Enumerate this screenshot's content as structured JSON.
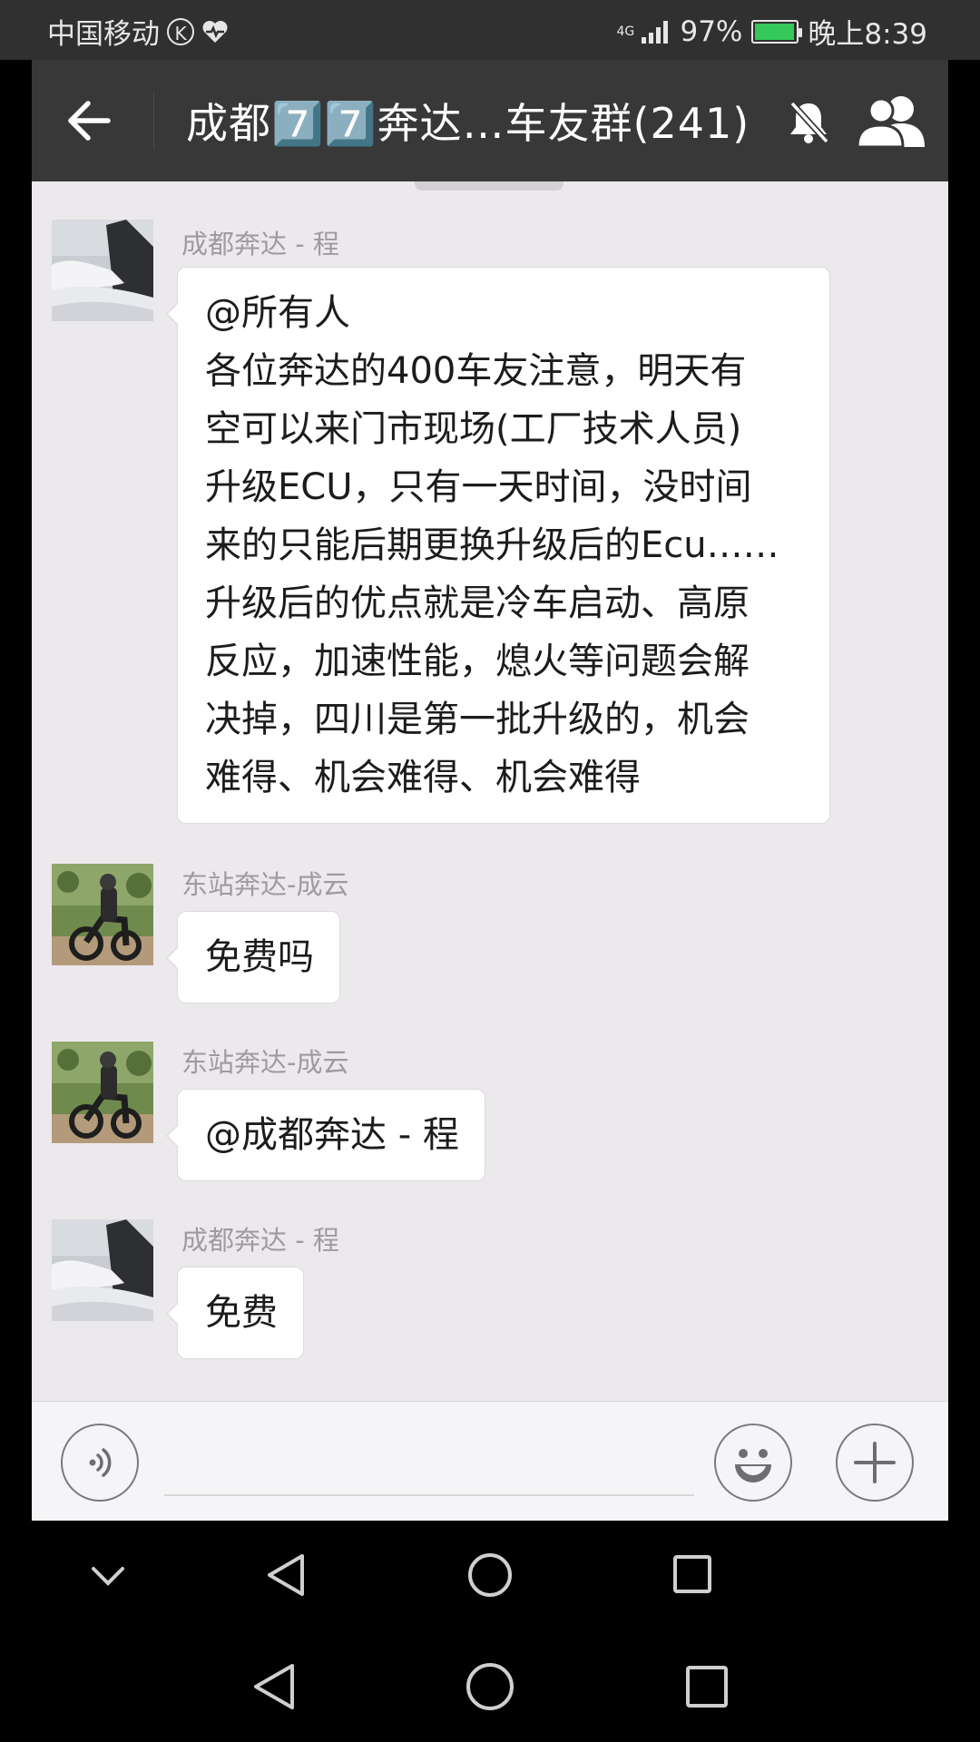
{
  "status_bar": {
    "carrier": "中国移动",
    "network": "4G",
    "battery_percent": "97%",
    "battery_level": 0.97,
    "time": "晚上8:39"
  },
  "header": {
    "title": "成都7️⃣7️⃣奔达…车友群(241)",
    "icons": {
      "back": "arrow-left-icon",
      "mute": "bell-off-icon",
      "members": "group-icon"
    }
  },
  "messages": [
    {
      "sender": "成都奔达 - 程",
      "avatar": "cloud-sea-mountain",
      "lines": [
        "@所有人",
        "各位奔达的400车友注意，明天有",
        "空可以来门市现场(工厂技术人员)",
        "升级ECU，只有一天时间，没时间",
        "来的只能后期更换升级后的Ecu……",
        "升级后的优点就是冷车启动、高原",
        "反应，加速性能，熄火等问题会解",
        "决掉，四川是第一批升级的，机会",
        "难得、机会难得、机会难得"
      ]
    },
    {
      "sender": "东站奔达-成云",
      "avatar": "motorcycle-rider",
      "lines": [
        "免费吗"
      ]
    },
    {
      "sender": "东站奔达-成云",
      "avatar": "motorcycle-rider",
      "lines": [
        "@成都奔达 - 程"
      ]
    },
    {
      "sender": "成都奔达 - 程",
      "avatar": "cloud-sea-mountain",
      "lines": [
        "免费"
      ]
    }
  ],
  "input_bar": {
    "text": "",
    "icons": {
      "voice": "voice-icon",
      "emoji": "smile-icon",
      "more": "plus-icon"
    }
  },
  "nav_bars": {
    "icons": [
      "chevron-down-icon",
      "back-triangle-icon",
      "home-circle-icon",
      "recents-square-icon"
    ]
  },
  "colors": {
    "title_bar": "#383838",
    "chat_bg": "#ece9ed",
    "bubble": "#ffffff",
    "sender_text": "#9e9a9e",
    "battery_green": "#34c759"
  }
}
